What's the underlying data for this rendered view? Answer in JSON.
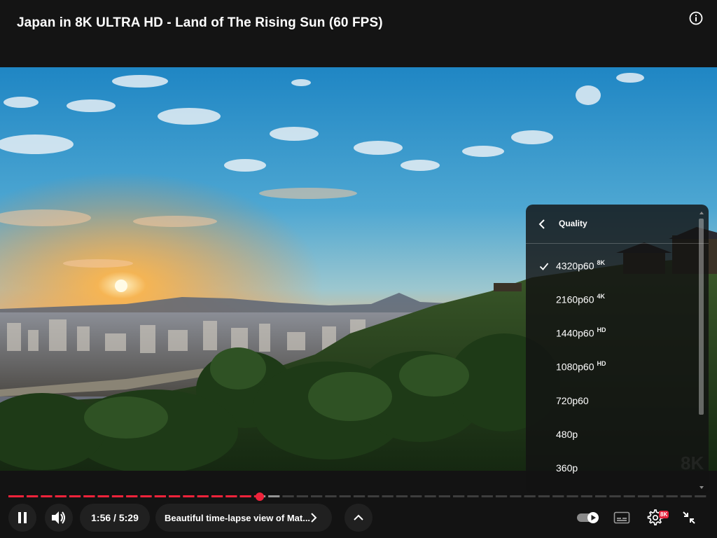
{
  "video": {
    "title": "Japan in 8K ULTRA HD - Land of The Rising Sun (60 FPS)",
    "watermark": "8K"
  },
  "player": {
    "current_time": "1:56",
    "separator": "/",
    "duration": "5:29",
    "chapter_title": "Beautiful time-lapse view of Mat...",
    "progress_played": 0.36,
    "progress_buffered": 0.39,
    "settings_badge": "8K",
    "accent_color": "#f0233b"
  },
  "quality_menu": {
    "header": "Quality",
    "options": [
      {
        "label": "4320p60",
        "badge": "8K",
        "selected": true
      },
      {
        "label": "2160p60",
        "badge": "4K",
        "selected": false
      },
      {
        "label": "1440p60",
        "badge": "HD",
        "selected": false
      },
      {
        "label": "1080p60",
        "badge": "HD",
        "selected": false
      },
      {
        "label": "720p60",
        "badge": "",
        "selected": false
      },
      {
        "label": "480p",
        "badge": "",
        "selected": false
      },
      {
        "label": "360p",
        "badge": "",
        "selected": false
      }
    ]
  },
  "icons": {
    "info": "info-icon",
    "play_pause": "pause-icon",
    "volume": "volume-icon",
    "chapter_next": "chevron-right-icon",
    "expand": "chevron-up-icon",
    "autoplay": "autoplay-toggle-icon",
    "subtitles": "subtitles-icon",
    "settings": "gear-icon",
    "fullscreen_exit": "exit-fullscreen-icon",
    "back": "chevron-left-icon",
    "check": "check-icon"
  }
}
